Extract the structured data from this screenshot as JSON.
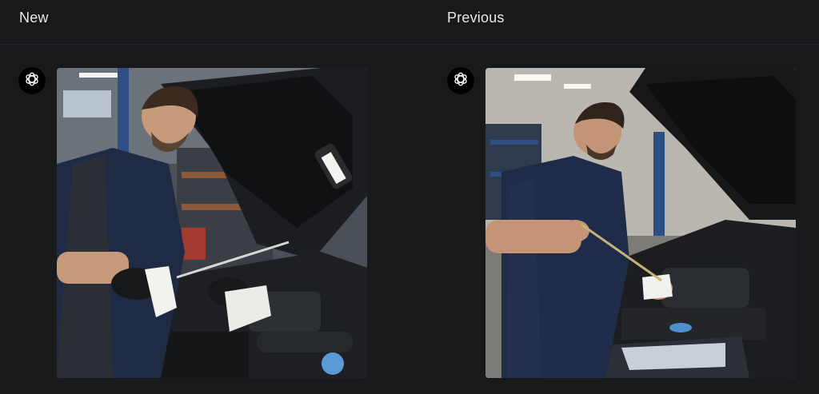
{
  "columns": {
    "new": {
      "title": "New"
    },
    "previous": {
      "title": "Previous"
    }
  },
  "images": {
    "new": {
      "subject": "mechanic-checking-oil-dipstick-new"
    },
    "previous": {
      "subject": "mechanic-checking-oil-dipstick-previous"
    }
  },
  "icons": {
    "assistant": "openai-logo-icon"
  },
  "colors": {
    "background": "#18191b",
    "header_text": "#e9e9ea",
    "avatar_bg": "#000000"
  }
}
